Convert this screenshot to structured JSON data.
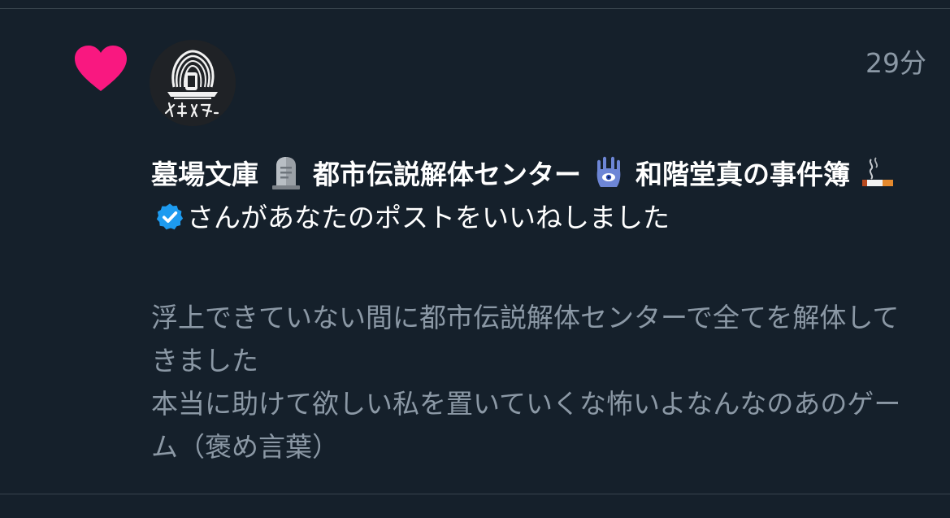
{
  "timestamp": "29分",
  "notification": {
    "name_part1": "墓場文庫",
    "name_part2": "都市伝説解体センター",
    "name_part3": "和階堂真の事件簿",
    "action_text": "さんがあなたのポストをいいねしました",
    "emoji_names": [
      "headstone-emoji",
      "hamsa-emoji",
      "cigarette-emoji"
    ]
  },
  "post": {
    "lines": [
      "浮上できていない間に都市伝説解体センターで全てを解体してきました",
      "本当に助けて欲しい私を置いていくな怖いよなんなのあのゲーム（褒め言葉）"
    ]
  },
  "colors": {
    "background": "#15202b",
    "heart": "#f91880",
    "verified": "#1d9bf0",
    "secondary_text": "#8b98a5"
  }
}
